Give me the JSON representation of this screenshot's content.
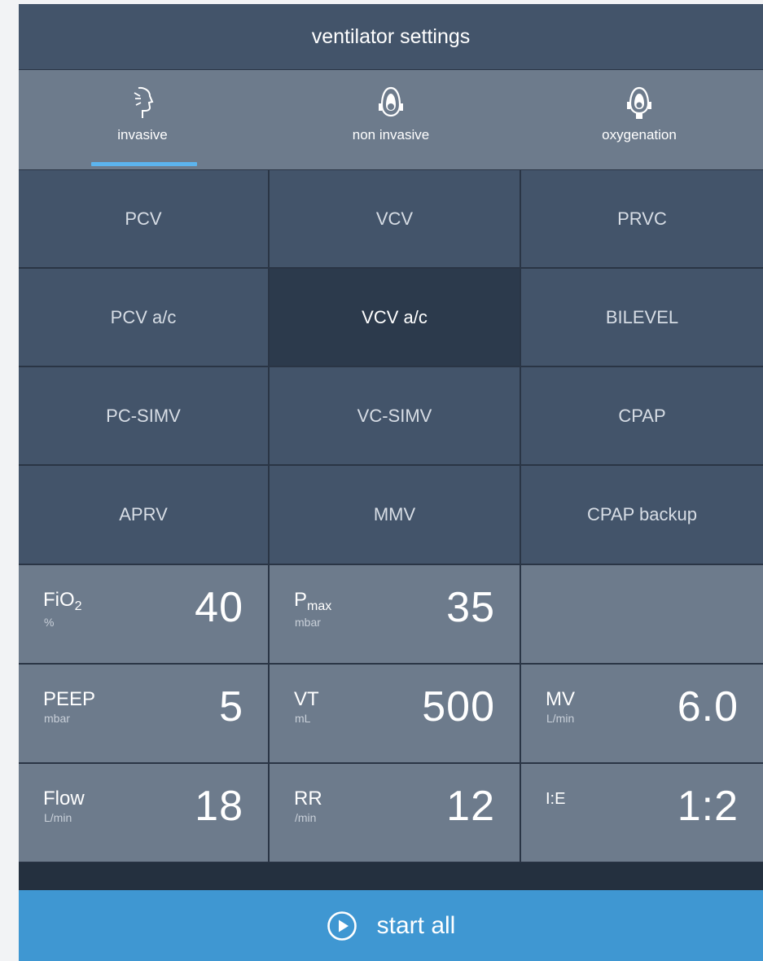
{
  "header": {
    "title": "ventilator settings"
  },
  "tabs": [
    {
      "label": "invasive",
      "icon": "face-profile-icon",
      "active": true
    },
    {
      "label": "non invasive",
      "icon": "mask-icon",
      "active": false
    },
    {
      "label": "oxygenation",
      "icon": "oxygen-mask-icon",
      "active": false
    }
  ],
  "modes": [
    [
      "PCV",
      "VCV",
      "PRVC"
    ],
    [
      "PCV a/c",
      "VCV a/c",
      "BILEVEL"
    ],
    [
      "PC-SIMV",
      "VC-SIMV",
      "CPAP"
    ],
    [
      "APRV",
      "MMV",
      "CPAP backup"
    ]
  ],
  "selected_mode": "VCV a/c",
  "params": {
    "fio2": {
      "name": "FiO",
      "sub": "2",
      "unit": "%",
      "value": "40"
    },
    "pmax": {
      "name": "P",
      "sub": "max",
      "unit": "mbar",
      "value": "35"
    },
    "peep": {
      "name": "PEEP",
      "unit": "mbar",
      "value": "5"
    },
    "vt": {
      "name": "VT",
      "unit": "mL",
      "value": "500"
    },
    "mv": {
      "name": "MV",
      "unit": "L/min",
      "value": "6.0"
    },
    "flow": {
      "name": "Flow",
      "unit": "L/min",
      "value": "18"
    },
    "rr": {
      "name": "RR",
      "unit": "/min",
      "value": "12"
    },
    "ie": {
      "name": "I:E",
      "value": "1:2"
    }
  },
  "start_button": {
    "label": "start all",
    "icon": "play-circle-icon"
  },
  "colors": {
    "header": "#43546a",
    "tab_bar": "#6d7b8c",
    "mode_cell": "#43546a",
    "mode_selected": "#2c3a4c",
    "accent": "#5cb4ee",
    "start_button": "#3f97d2"
  }
}
